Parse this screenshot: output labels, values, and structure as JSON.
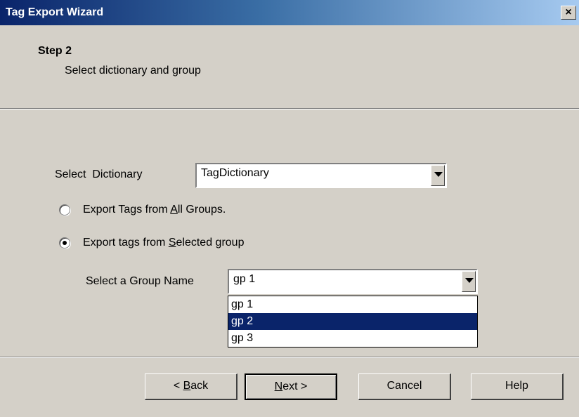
{
  "window": {
    "title": "Tag Export Wizard",
    "close_glyph": "×"
  },
  "header": {
    "step": "Step 2",
    "subtitle": "Select dictionary and group"
  },
  "dictionary": {
    "label": "Select  Dictionary",
    "value": "TagDictionary"
  },
  "radios": [
    {
      "pre": "Export Tags from ",
      "key": "A",
      "post": "ll Groups.",
      "checked": false
    },
    {
      "pre": "Export tags from ",
      "key": "S",
      "post": "elected group",
      "checked": true
    }
  ],
  "group": {
    "label": "Select a Group Name",
    "value": "gp 1",
    "options": [
      "gp 1",
      "gp 2",
      "gp 3"
    ],
    "highlighted": "gp 2"
  },
  "buttons": {
    "back": {
      "pre": "< ",
      "key": "B",
      "post": "ack"
    },
    "next": {
      "pre": "",
      "key": "N",
      "post": "ext >"
    },
    "cancel": "Cancel",
    "help": "Help"
  },
  "colors": {
    "title_gradient_start": "#0a246a",
    "selection": "#0a246a",
    "face": "#d4d0c8"
  }
}
